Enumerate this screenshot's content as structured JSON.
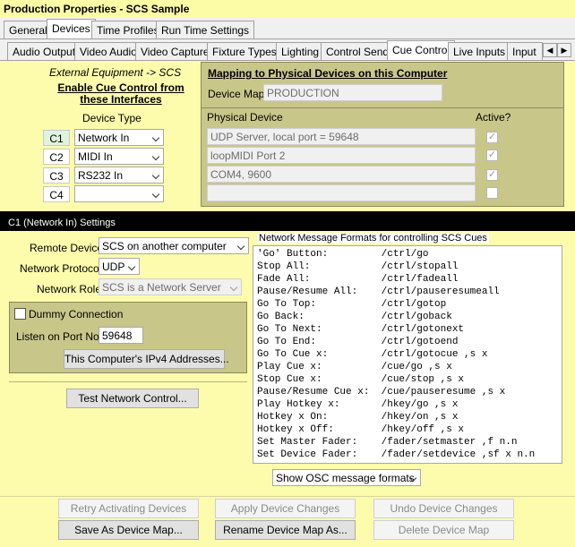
{
  "window": {
    "title": "Production Properties - SCS Sample"
  },
  "main_tabs": [
    "General",
    "Devices",
    "Time Profiles",
    "Run Time Settings"
  ],
  "sub_tabs": [
    "Audio Output",
    "Video Audio",
    "Video Capture",
    "Fixture Types",
    "Lighting",
    "Control Send",
    "Cue Control",
    "Live Inputs",
    "Input"
  ],
  "left": {
    "ext_label": "External Equipment -> SCS",
    "enable_title_line1": "Enable Cue Control from",
    "enable_title_line2": "these Interfaces",
    "device_type_header": "Device Type",
    "rows": [
      {
        "code": "C1",
        "type": "Network In"
      },
      {
        "code": "C2",
        "type": "MIDI In"
      },
      {
        "code": "C3",
        "type": "RS232 In"
      },
      {
        "code": "C4",
        "type": ""
      }
    ]
  },
  "right": {
    "mapping_title": "Mapping to Physical Devices on this Computer",
    "device_map_label": "Device Map",
    "device_map_value": "PRODUCTION",
    "physical_header": "Physical Device",
    "active_header": "Active?",
    "devices": [
      {
        "name": "UDP Server, local port = 59648",
        "active": "✓"
      },
      {
        "name": "loopMIDI Port 2",
        "active": "✓"
      },
      {
        "name": "COM4, 9600",
        "active": "✓"
      },
      {
        "name": "",
        "active": ""
      }
    ]
  },
  "settings": {
    "header": "C1 (Network In) Settings",
    "remote_device_label": "Remote Device",
    "remote_device_value": "SCS on another computer",
    "protocol_label": "Network Protocol",
    "protocol_value": "UDP",
    "role_label": "Network Role",
    "role_value": "SCS is a Network Server",
    "dummy_label": "Dummy Connection",
    "port_label": "Listen on Port No.",
    "port_value": "59648",
    "ipv4_button": "This Computer's IPv4 Addresses...",
    "test_button": "Test Network Control..."
  },
  "messages": {
    "title": "Network Message Formats for controlling SCS Cues",
    "lines": [
      "'Go' Button:         /ctrl/go",
      "Stop All:            /ctrl/stopall",
      "Fade All:            /ctrl/fadeall",
      "Pause/Resume All:    /ctrl/pauseresumeall",
      "Go To Top:           /ctrl/gotop",
      "Go Back:             /ctrl/goback",
      "Go To Next:          /ctrl/gotonext",
      "Go To End:           /ctrl/gotoend",
      "Go To Cue x:         /ctrl/gotocue ,s x",
      "Play Cue x:          /cue/go ,s x",
      "Stop Cue x:          /cue/stop ,s x",
      "Pause/Resume Cue x:  /cue/pauseresume ,s x",
      "Play Hotkey x:       /hkey/go ,s x",
      "Hotkey x On:         /hkey/on ,s x",
      "Hotkey x Off:        /hkey/off ,s x",
      "Set Master Fader:    /fader/setmaster ,f n.n",
      "Set Device Fader:    /fader/setdevice ,sf x n.n"
    ],
    "format_select": "Show OSC message formats"
  },
  "bottom_buttons": {
    "retry": "Retry Activating Devices",
    "apply": "Apply Device Changes",
    "undo": "Undo Device Changes",
    "save_as": "Save As Device Map...",
    "rename": "Rename Device Map As...",
    "delete": "Delete Device Map"
  }
}
